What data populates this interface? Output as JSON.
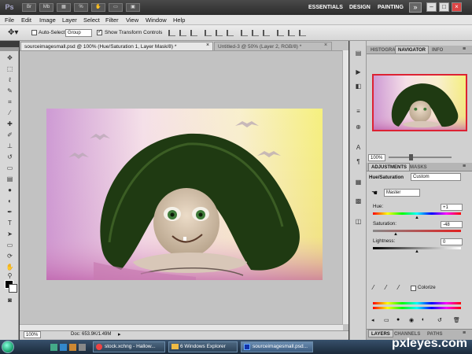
{
  "app": {
    "logo": "Ps"
  },
  "titlebar": {
    "workspaces": [
      "ESSENTIALS",
      "DESIGN",
      "PAINTING"
    ],
    "more": "»",
    "window_buttons": [
      "–",
      "□",
      "×"
    ]
  },
  "menu": [
    "File",
    "Edit",
    "Image",
    "Layer",
    "Select",
    "Filter",
    "View",
    "Window",
    "Help"
  ],
  "options": {
    "auto_select_label": "Auto-Select:",
    "auto_select_value": "Group",
    "show_transform_label": "Show Transform Controls"
  },
  "document_tabs": [
    {
      "label": "sourceimagesmall.psd @ 100% (Hue/Saturation 1, Layer Mask/8) *",
      "close": "×"
    },
    {
      "label": "Untitled-3 @ 50% (Layer 2, RGB/8) *",
      "close": "×"
    }
  ],
  "status": {
    "zoom": "100%",
    "doc": "Doc: 653.9K/1.49M"
  },
  "panels": {
    "top_tabs": [
      "HISTOGRA",
      "NAVIGATOR",
      "INFO"
    ],
    "nav_zoom": "100%",
    "adj_tabs": [
      "ADJUSTMENTS",
      "MASKS"
    ],
    "adj_title": "Hue/Saturation",
    "preset": "Custom",
    "channel": "Master",
    "hue_label": "Hue:",
    "hue_value": "+1",
    "sat_label": "Saturation:",
    "sat_value": "-48",
    "light_label": "Lightness:",
    "light_value": "0",
    "colorize_label": "Colorize",
    "bottom_tabs": [
      "LAYERS",
      "CHANNELS",
      "PATHS"
    ]
  },
  "taskbar": {
    "tasks": [
      "stock.xchng - Hallow...",
      "6 Windows Explorer",
      "sourceimagesmall.psd..."
    ]
  },
  "watermark": "pxleyes.com",
  "colors": {
    "accent_red": "#d02020",
    "nav_frame": "#d22233"
  }
}
